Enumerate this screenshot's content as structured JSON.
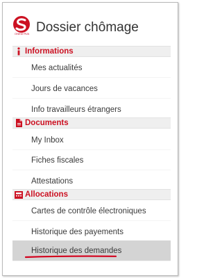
{
  "header": {
    "title": "Dossier chômage",
    "logo_icon": "onem-logo-icon",
    "logo_caption": "ONEM·RVA"
  },
  "colors": {
    "accent": "#cc1122",
    "section_bg": "#efefef",
    "active_bg": "#d4d4d4",
    "text": "#3a3a3a"
  },
  "sections": [
    {
      "label": "Informations",
      "icon": "info-icon",
      "items": [
        {
          "label": "Mes actualités"
        },
        {
          "label": "Jours de vacances"
        },
        {
          "label": "Info travailleurs étrangers"
        }
      ]
    },
    {
      "label": "Documents",
      "icon": "document-icon",
      "items": [
        {
          "label": "My Inbox"
        },
        {
          "label": "Fiches fiscales"
        },
        {
          "label": "Attestations"
        }
      ]
    },
    {
      "label": "Allocations",
      "icon": "calculator-icon",
      "items": [
        {
          "label": "Cartes de contrôle électroniques"
        },
        {
          "label": "Historique des payements"
        },
        {
          "label": "Historique des demandes",
          "active": true
        }
      ]
    }
  ]
}
